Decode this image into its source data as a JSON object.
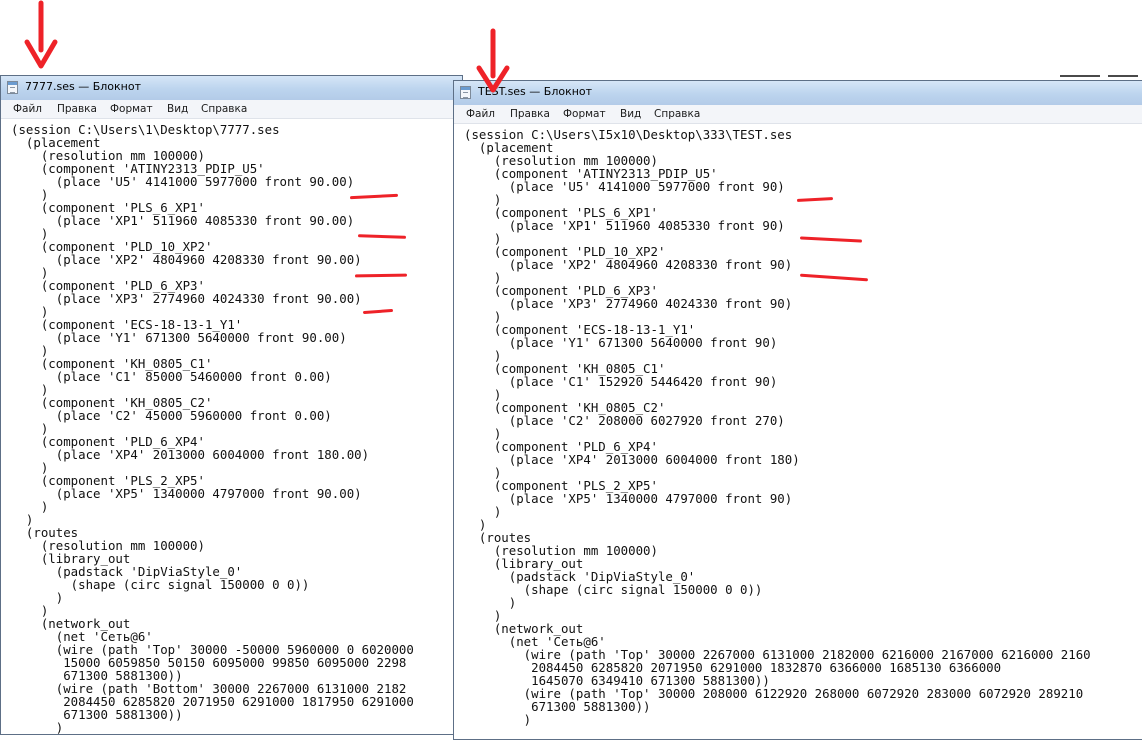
{
  "left_window": {
    "title": "7777.ses — Блокнот",
    "menu": [
      "Файл",
      "Правка",
      "Формат",
      "Вид",
      "Справка"
    ],
    "content": "(session C:\\Users\\1\\Desktop\\7777.ses\n  (placement\n    (resolution mm 100000)\n    (component 'ATINY2313_PDIP_U5'\n      (place 'U5' 4141000 5977000 front 90.00)\n    )\n    (component 'PLS_6_XP1'\n      (place 'XP1' 511960 4085330 front 90.00)\n    )\n    (component 'PLD_10_XP2'\n      (place 'XP2' 4804960 4208330 front 90.00)\n    )\n    (component 'PLD_6_XP3'\n      (place 'XP3' 2774960 4024330 front 90.00)\n    )\n    (component 'ECS-18-13-1_Y1'\n      (place 'Y1' 671300 5640000 front 90.00)\n    )\n    (component 'KH_0805_C1'\n      (place 'C1' 85000 5460000 front 0.00)\n    )\n    (component 'KH_0805_C2'\n      (place 'C2' 45000 5960000 front 0.00)\n    )\n    (component 'PLD_6_XP4'\n      (place 'XP4' 2013000 6004000 front 180.00)\n    )\n    (component 'PLS_2_XP5'\n      (place 'XP5' 1340000 4797000 front 90.00)\n    )\n  )\n  (routes\n    (resolution mm 100000)\n    (library_out\n      (padstack 'DipViaStyle_0'\n        (shape (circ signal 150000 0 0))\n      )\n    )\n    (network_out\n      (net 'Сеть@6'\n      (wire (path 'Top' 30000 -50000 5960000 0 6020000\n       15000 6059850 50150 6095000 99850 6095000 2298\n       671300 5881300))\n      (wire (path 'Bottom' 30000 2267000 6131000 2182\n       2084450 6285820 2071950 6291000 1817950 6291000\n       671300 5881300))\n      )"
  },
  "right_window": {
    "title": "TEST.ses — Блокнот",
    "menu": [
      "Файл",
      "Правка",
      "Формат",
      "Вид",
      "Справка"
    ],
    "content": "(session C:\\Users\\I5x10\\Desktop\\333\\TEST.ses\n  (placement\n    (resolution mm 100000)\n    (component 'ATINY2313_PDIP_U5'\n      (place 'U5' 4141000 5977000 front 90)\n    )\n    (component 'PLS_6_XP1'\n      (place 'XP1' 511960 4085330 front 90)\n    )\n    (component 'PLD_10_XP2'\n      (place 'XP2' 4804960 4208330 front 90)\n    )\n    (component 'PLD_6_XP3'\n      (place 'XP3' 2774960 4024330 front 90)\n    )\n    (component 'ECS-18-13-1_Y1'\n      (place 'Y1' 671300 5640000 front 90)\n    )\n    (component 'KH_0805_C1'\n      (place 'C1' 152920 5446420 front 90)\n    )\n    (component 'KH_0805_C2'\n      (place 'C2' 208000 6027920 front 270)\n    )\n    (component 'PLD_6_XP4'\n      (place 'XP4' 2013000 6004000 front 180)\n    )\n    (component 'PLS_2_XP5'\n      (place 'XP5' 1340000 4797000 front 90)\n    )\n  )\n  (routes\n    (resolution mm 100000)\n    (library_out\n      (padstack 'DipViaStyle_0'\n        (shape (circ signal 150000 0 0))\n      )\n    )\n    (network_out\n      (net 'Сеть@6'\n        (wire (path 'Top' 30000 2267000 6131000 2182000 6216000 2167000 6216000 2160\n         2084450 6285820 2071950 6291000 1832870 6366000 1685130 6366000\n         1645070 6349410 671300 5881300))\n        (wire (path 'Top' 30000 208000 6122920 268000 6072920 283000 6072920 289210\n         671300 5881300))\n        )"
  },
  "annotations": {
    "arrow_color": "#ee2228",
    "underline_color": "#ee2228"
  }
}
